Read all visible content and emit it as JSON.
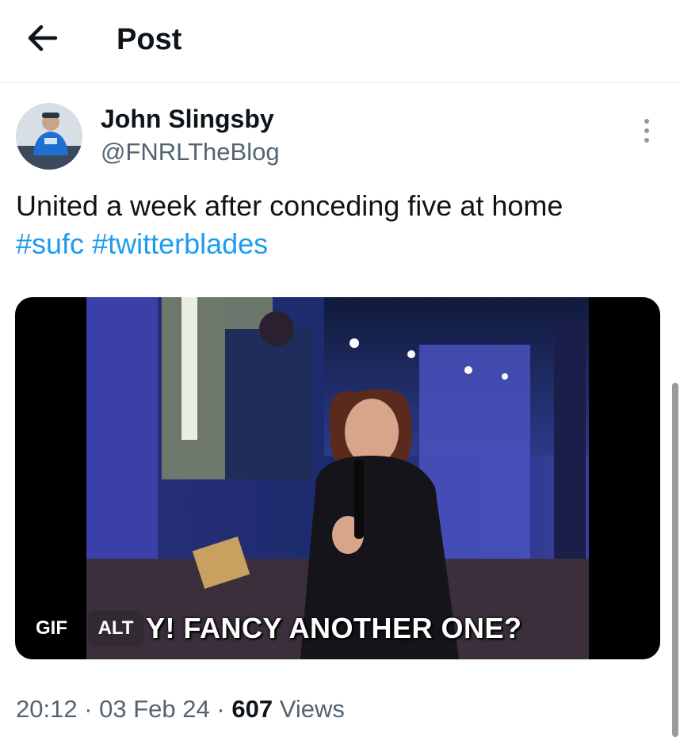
{
  "header": {
    "title": "Post",
    "back_icon": "arrow-left-icon"
  },
  "post": {
    "author": {
      "name": "John Slingsby",
      "handle": "@FNRLTheBlog"
    },
    "more_icon": "more-vertical-icon",
    "text": "United a week after conceding five at home",
    "hashtags": [
      "#sufc",
      "#twitterblades"
    ],
    "media": {
      "gif_badge": "GIF",
      "alt_badge": "ALT",
      "caption": "Y! FANCY ANOTHER ONE?"
    },
    "meta": {
      "time": "20:12",
      "date": "03 Feb 24",
      "views_count": "607",
      "views_label": "Views"
    }
  },
  "colors": {
    "hashtag": "#1d9bf0",
    "secondary_text": "#536471",
    "primary_text": "#0f1419"
  }
}
